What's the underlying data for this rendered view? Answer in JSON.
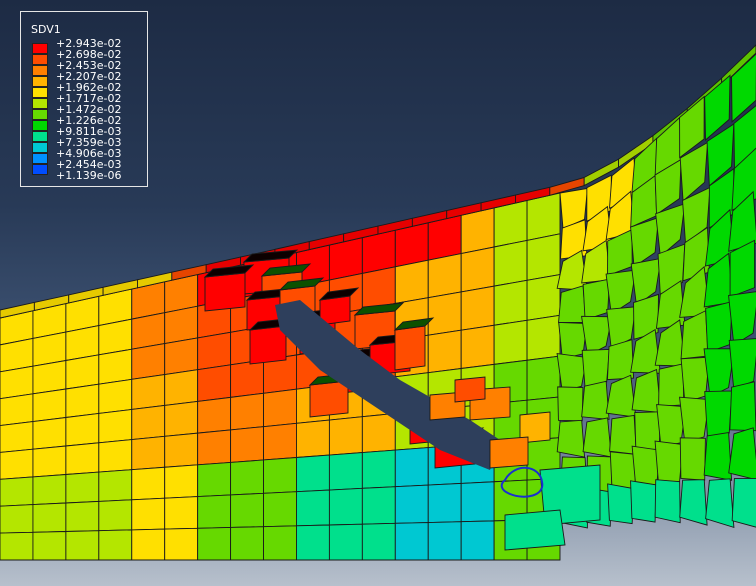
{
  "legend": {
    "variable_name": "SDV1",
    "entries": [
      {
        "label": "+2.943e-02",
        "color": "#ff0000"
      },
      {
        "label": "+2.698e-02",
        "color": "#ff4d00"
      },
      {
        "label": "+2.453e-02",
        "color": "#ff8000"
      },
      {
        "label": "+2.207e-02",
        "color": "#ffb300"
      },
      {
        "label": "+1.962e-02",
        "color": "#ffe000"
      },
      {
        "label": "+1.717e-02",
        "color": "#b4e600"
      },
      {
        "label": "+1.472e-02",
        "color": "#66d900"
      },
      {
        "label": "+1.226e-02",
        "color": "#00d900"
      },
      {
        "label": "+9.811e-03",
        "color": "#00e08c"
      },
      {
        "label": "+7.359e-03",
        "color": "#00c8d2"
      },
      {
        "label": "+4.906e-03",
        "color": "#0091ff"
      },
      {
        "label": "+2.454e-03",
        "color": "#004dff"
      },
      {
        "label": "+1.139e-06",
        "color": "#0000ff"
      }
    ]
  },
  "colors": {
    "background_top": "#1d2b44",
    "background_bottom": "#b7c0cc",
    "mesh_edge": "#1a1a1a",
    "highlight_contour": "#1a2fd0"
  }
}
